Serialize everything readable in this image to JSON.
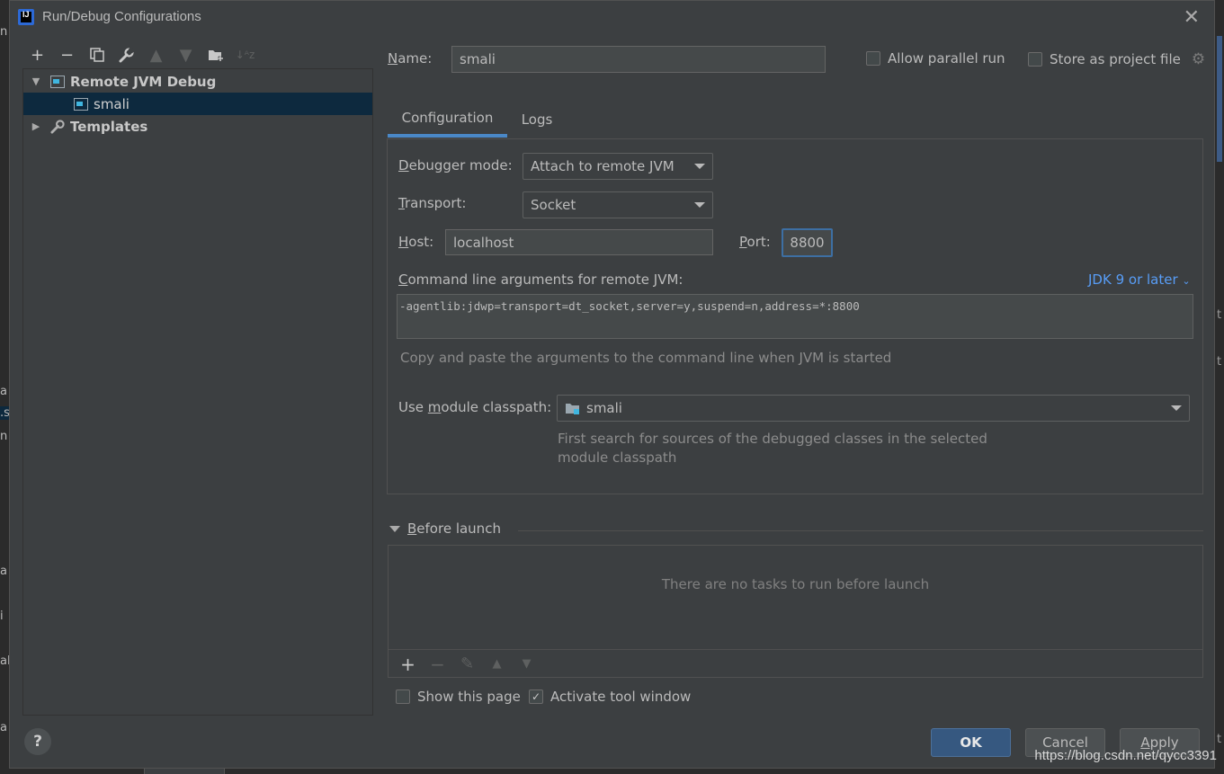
{
  "window": {
    "title": "Run/Debug Configurations",
    "app_icon": "intellij-idea-icon",
    "app_icon_text": "IJ"
  },
  "toolbar": {
    "icons": [
      "add-icon",
      "remove-icon",
      "copy-icon",
      "wrench-icon",
      "move-up-icon",
      "move-down-icon",
      "folder-add-icon",
      "sort-az-icon"
    ]
  },
  "tree": {
    "items": [
      {
        "label": "Remote JVM Debug",
        "expanded": true,
        "bold": true
      },
      {
        "label": "smali",
        "selected": true
      },
      {
        "label": "Templates",
        "expanded": false,
        "bold": true
      }
    ]
  },
  "header": {
    "name_label": "Name:",
    "name_value": "smali",
    "allow_parallel_label": "Allow parallel run",
    "allow_parallel_checked": false,
    "store_label": "Store as project file",
    "store_checked": false
  },
  "tabs": [
    {
      "label": "Configuration",
      "active": true
    },
    {
      "label": "Logs",
      "active": false
    }
  ],
  "config": {
    "debugger_mode_label": "Debugger mode:",
    "debugger_mode_value": "Attach to remote JVM",
    "transport_label": "Transport:",
    "transport_value": "Socket",
    "host_label": "Host:",
    "host_value": "localhost",
    "port_label": "Port:",
    "port_value": "8800",
    "cmd_label": "Command line arguments for remote JVM:",
    "jdk_link": "JDK 9 or later",
    "cmd_value": "-agentlib:jdwp=transport=dt_socket,server=y,suspend=n,address=*:8800",
    "cmd_hint": "Copy and paste the arguments to the command line when JVM is started",
    "module_label": "Use module classpath:",
    "module_value": "smali",
    "module_hint_1": "First search for sources of the debugged classes in the selected",
    "module_hint_2": "module classpath"
  },
  "before_launch": {
    "title": "Before launch",
    "empty_text": "There are no tasks to run before launch"
  },
  "footer": {
    "show_page_label": "Show this page",
    "show_page_checked": false,
    "activate_tool_label": "Activate tool window",
    "activate_tool_checked": true,
    "ok_label": "OK",
    "cancel_label": "Cancel",
    "apply_label": "Apply",
    "help_label": "?"
  },
  "watermark": "https://blog.csdn.net/qycc3391",
  "colors": {
    "background": "#3c3f41",
    "selection": "#0d293e",
    "accent": "#4a88c7",
    "link": "#589df6",
    "primary_button": "#365880"
  }
}
